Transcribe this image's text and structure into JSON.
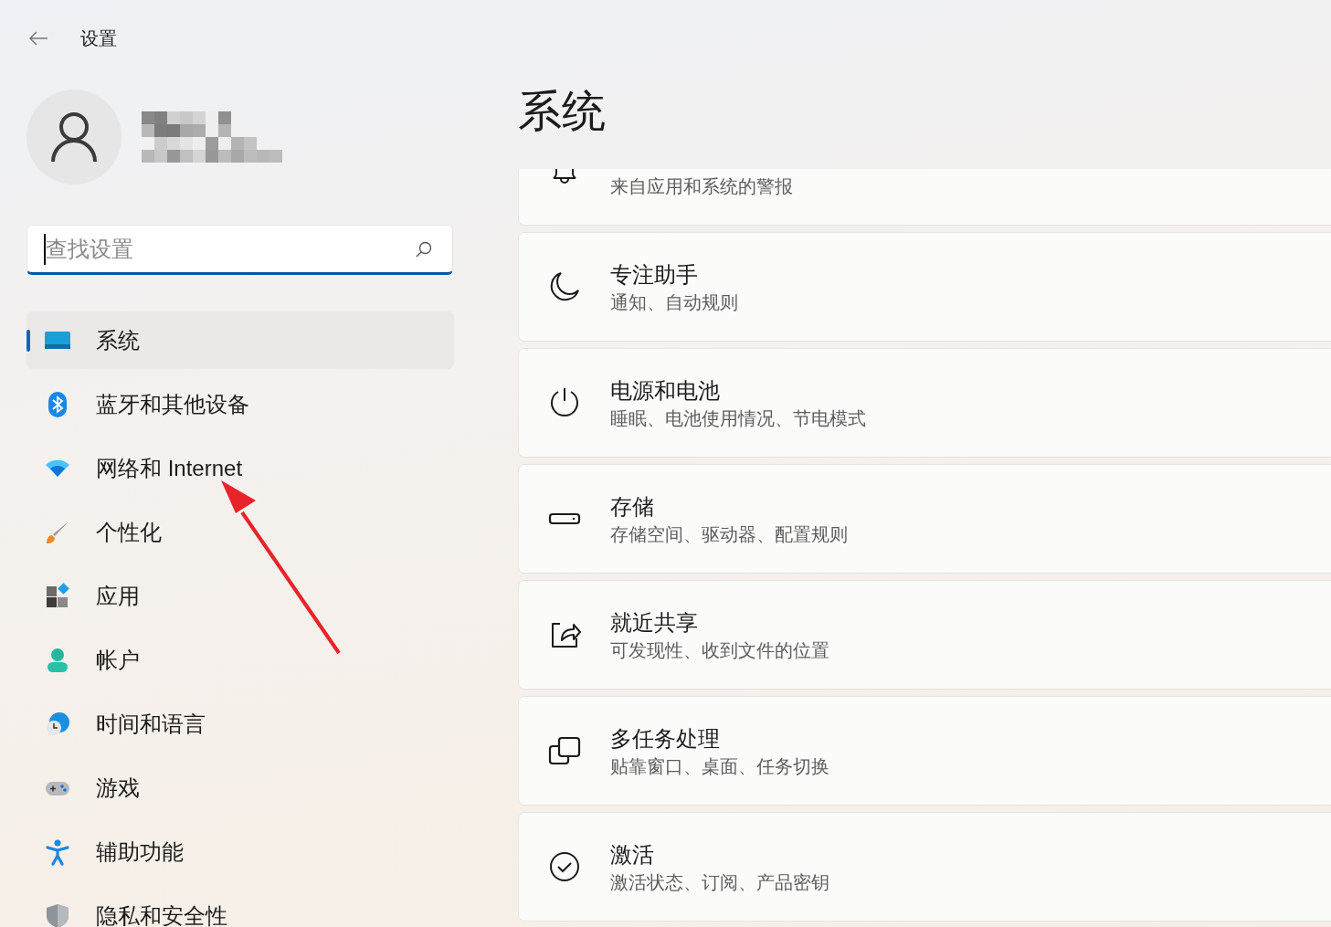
{
  "window": {
    "title": "设置"
  },
  "search": {
    "placeholder": "查找设置"
  },
  "sidebar": {
    "items": [
      {
        "label": "系统",
        "selected": true
      },
      {
        "label": "蓝牙和其他设备",
        "selected": false
      },
      {
        "label": "网络和 Internet",
        "selected": false
      },
      {
        "label": "个性化",
        "selected": false
      },
      {
        "label": "应用",
        "selected": false
      },
      {
        "label": "帐户",
        "selected": false
      },
      {
        "label": "时间和语言",
        "selected": false
      },
      {
        "label": "游戏",
        "selected": false
      },
      {
        "label": "辅助功能",
        "selected": false
      },
      {
        "label": "隐私和安全性",
        "selected": false
      }
    ]
  },
  "page": {
    "title": "系统"
  },
  "settings": [
    {
      "subtitle": "来自应用和系统的警报"
    },
    {
      "title": "专注助手",
      "subtitle": "通知、自动规则"
    },
    {
      "title": "电源和电池",
      "subtitle": "睡眠、电池使用情况、节电模式"
    },
    {
      "title": "存储",
      "subtitle": "存储空间、驱动器、配置规则"
    },
    {
      "title": "就近共享",
      "subtitle": "可发现性、收到文件的位置"
    },
    {
      "title": "多任务处理",
      "subtitle": "贴靠窗口、桌面、任务切换"
    },
    {
      "title": "激活",
      "subtitle": "激活状态、订阅、产品密钥"
    }
  ]
}
